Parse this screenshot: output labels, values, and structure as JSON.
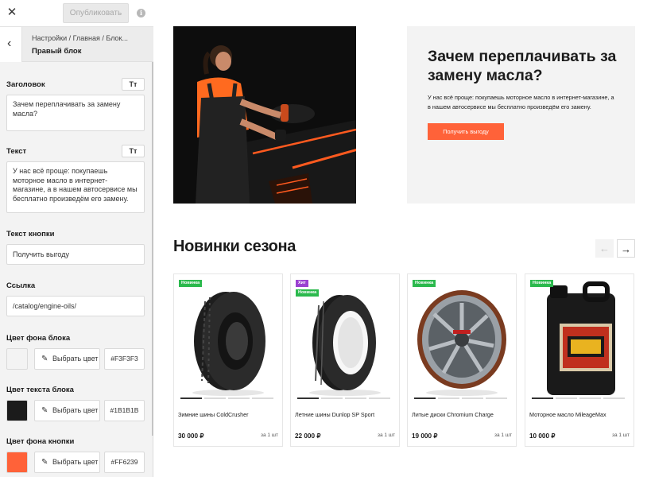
{
  "topbar": {
    "close_icon": "close-icon",
    "publish_label": "Опубликовать",
    "info_glyph": "i"
  },
  "breadcrumb": {
    "path": "Настройки / Главная / Блок...",
    "title": "Правый блок"
  },
  "form": {
    "heading_label": "Заголовок",
    "heading_value": "Зачем переплачивать за замену масла?",
    "text_label": "Текст",
    "text_value": "У нас всё проще: покупаешь моторное масло в интернет-магазине, а в нашем автосервисе мы бесплатно произведём его замену.",
    "tt_label": "Tт",
    "button_text_label": "Текст кнопки",
    "button_text_value": "Получить выгоду",
    "link_label": "Ссылка",
    "link_value": "/catalog/engine-oils/",
    "bg_color_label": "Цвет фона блока",
    "bg_color_value": "#F3F3F3",
    "text_color_label": "Цвет текста блока",
    "text_color_value": "#1B1B1B",
    "btn_color_label": "Цвет фона кнопки",
    "btn_color_value": "#FF6239",
    "pick_color_label": "Выбрать цвет"
  },
  "hero": {
    "title": "Зачем переплачивать за замену масла?",
    "text": "У нас всё проще: покупаешь моторное масло в интернет-магазине, а в нашем автосервисе мы бесплатно произведём его замену.",
    "button": "Получить выгоду"
  },
  "section": {
    "title": "Новинки сезона",
    "prev_arrow": "←",
    "next_arrow": "→"
  },
  "products": [
    {
      "badges": [
        "Новинка"
      ],
      "name": "Зимние шины ColdCrusher",
      "price": "30 000 ₽",
      "unit": "за 1 шт"
    },
    {
      "badges": [
        "Хит",
        "Новинка"
      ],
      "name": "Летние шины Dunlop SP Sport",
      "price": "22 000 ₽",
      "unit": "за 1 шт"
    },
    {
      "badges": [
        "Новинка"
      ],
      "name": "Литые диски Chromium Charge",
      "price": "19 000 ₽",
      "unit": "за 1 шт"
    },
    {
      "badges": [
        "Новинка"
      ],
      "name": "Моторное масло MileageMax",
      "price": "10 000 ₽",
      "unit": "за 1 шт"
    }
  ],
  "colors": {
    "accent": "#FF6239",
    "block_bg": "#F3F3F3",
    "text": "#1B1B1B",
    "badge_new": "#2BB94D",
    "badge_hit": "#9B41D1"
  }
}
